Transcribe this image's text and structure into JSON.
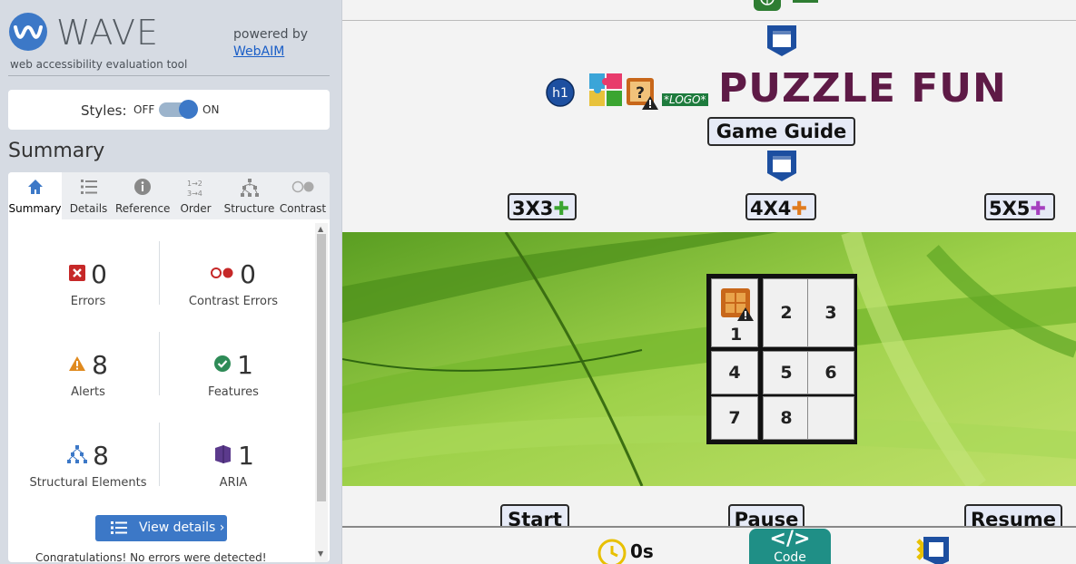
{
  "wave": {
    "title": "WAVE",
    "subtitle": "web accessibility evaluation tool",
    "powered_by": "powered by",
    "webaim_link": "WebAIM",
    "styles_label": "Styles:",
    "styles_off": "OFF",
    "styles_on": "ON",
    "styles_state": "on",
    "summary_heading": "Summary",
    "tabs": [
      {
        "label": "Summary",
        "icon": "home-icon",
        "active": true
      },
      {
        "label": "Details",
        "icon": "list-icon"
      },
      {
        "label": "Reference",
        "icon": "info-icon"
      },
      {
        "label": "Order",
        "icon": "order-icon"
      },
      {
        "label": "Structure",
        "icon": "structure-icon"
      },
      {
        "label": "Contrast",
        "icon": "contrast-icon"
      }
    ],
    "stats": {
      "errors": {
        "count": "0",
        "label": "Errors",
        "color": "#c62828"
      },
      "contrast_errors": {
        "count": "0",
        "label": "Contrast Errors",
        "color": "#c62828"
      },
      "alerts": {
        "count": "8",
        "label": "Alerts",
        "color": "#e08a1e"
      },
      "features": {
        "count": "1",
        "label": "Features",
        "color": "#2e8b57"
      },
      "structural": {
        "count": "8",
        "label": "Structural Elements",
        "color": "#3c78c7"
      },
      "aria": {
        "count": "1",
        "label": "ARIA",
        "color": "#5b3a8c"
      }
    },
    "view_details": "View details ›",
    "congrats": "Congratulations! No errors were detected!"
  },
  "page": {
    "h1_badge": "h1",
    "logo_text": "*LOGO*",
    "alert_badge": "?",
    "title": "PUZZLE FUN",
    "game_guide": "Game Guide",
    "size_buttons": [
      "3X3",
      "4X4",
      "5X5"
    ],
    "puzzle_colors": [
      "#3ba531",
      "#e07b1f",
      "#a53fbf"
    ],
    "tiles": [
      "1",
      "2",
      "3",
      "4",
      "5",
      "6",
      "7",
      "8",
      ""
    ],
    "controls": {
      "start": "Start",
      "pause": "Pause",
      "resume": "Resume"
    },
    "timer": "0s",
    "code_label": "Code",
    "code_symbol": "</>"
  },
  "colors": {
    "wave_blue": "#3c78c7",
    "title_color": "#5e1a46",
    "code_teal": "#1f8f86"
  }
}
